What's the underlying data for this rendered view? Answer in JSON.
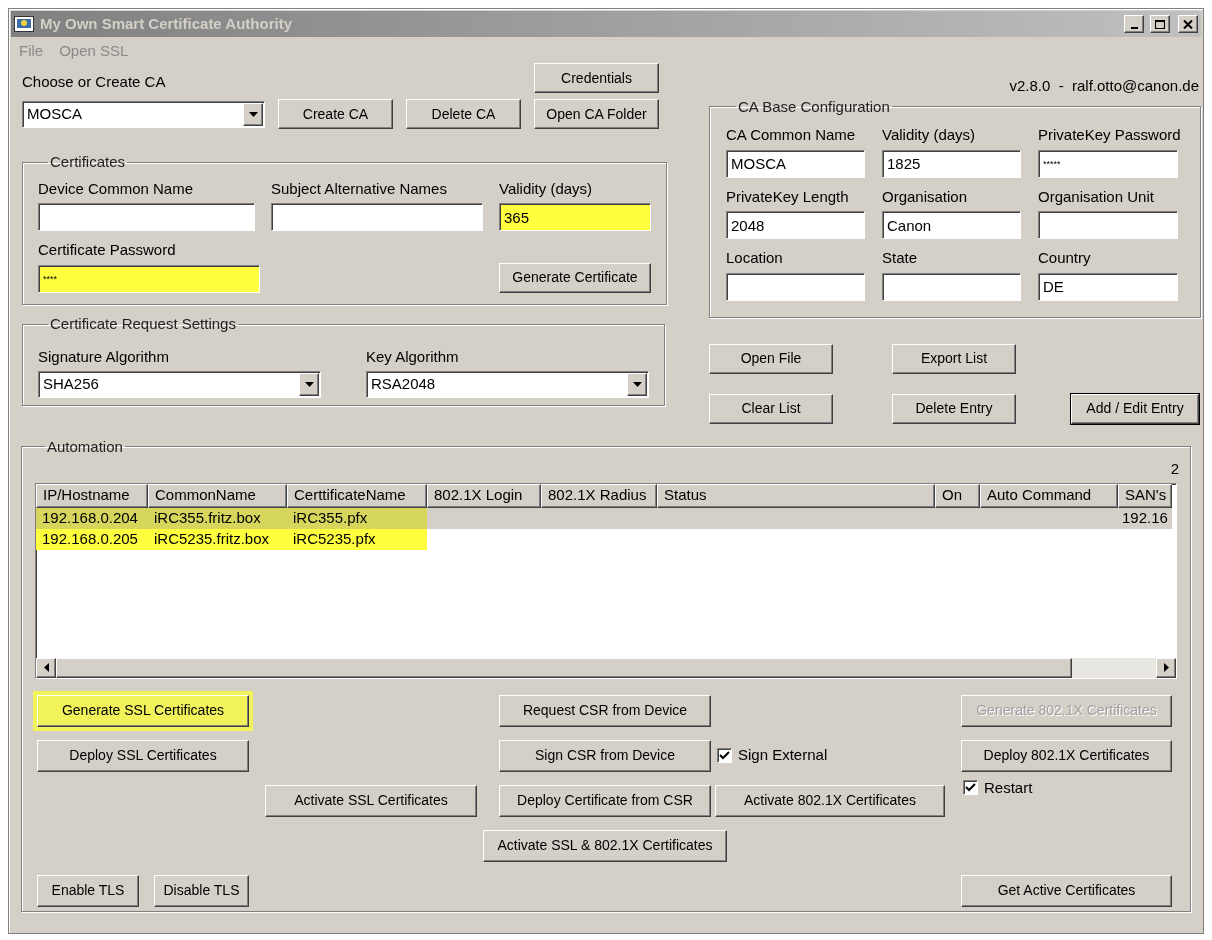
{
  "window": {
    "title": "My Own Smart Certificate Authority",
    "active": false
  },
  "menu": [
    {
      "label": "File"
    },
    {
      "label": "Open SSL"
    }
  ],
  "ca_chooser": {
    "label": "Choose or Create CA",
    "value": "MOSCA"
  },
  "top_buttons": [
    {
      "label": "Credentials"
    },
    {
      "label": "Create CA"
    },
    {
      "label": "Delete CA"
    },
    {
      "label": "Open CA Folder"
    }
  ],
  "version": "v2.8.0  -  ralf.otto@canon.de",
  "certificates": {
    "title": "Certificates",
    "fields": [
      {
        "label": "Device Common Name",
        "kind": "text",
        "highlighted": false
      },
      {
        "label": "Subject Alternative Names",
        "kind": "text",
        "highlighted": false
      },
      {
        "label": "Validity (days)",
        "value": "365",
        "kind": "text",
        "highlighted": true
      },
      {
        "label": "Certificate Password",
        "value": "****",
        "kind": "password",
        "highlighted": true
      }
    ],
    "button": {
      "label": "Generate Certificate"
    }
  },
  "request_settings": {
    "title": "Certificate Request Settings",
    "selects": [
      {
        "label": "Signature Algorithm",
        "value": "SHA256"
      },
      {
        "label": "Key Algorithm",
        "value": "RSA2048"
      }
    ]
  },
  "ca_base": {
    "title": "CA Base Configuration",
    "fields": [
      {
        "label": "CA Common Name",
        "value": "MOSCA",
        "kind": "text"
      },
      {
        "label": "Validity (days)",
        "value": "1825",
        "kind": "text"
      },
      {
        "label": "PrivateKey Password",
        "value": "*****",
        "kind": "password"
      },
      {
        "label": "PrivateKey Length",
        "value": "2048",
        "kind": "text"
      },
      {
        "label": "Organisation",
        "value": "Canon",
        "kind": "text"
      },
      {
        "label": "Organisation Unit",
        "kind": "text"
      },
      {
        "label": "Location",
        "kind": "text"
      },
      {
        "label": "State",
        "kind": "text"
      },
      {
        "label": "Country",
        "value": "DE",
        "kind": "text"
      }
    ]
  },
  "list_buttons": [
    {
      "label": "Open File",
      "default": false
    },
    {
      "label": "Export List",
      "default": false
    },
    {
      "label": "Clear List",
      "default": false
    },
    {
      "label": "Delete Entry",
      "default": false
    },
    {
      "label": "Add / Edit Entry",
      "default": true
    }
  ],
  "automation": {
    "title": "Automation",
    "count": "2",
    "table": {
      "columns": [
        "IP/Hostname",
        "CommonName",
        "CerttificateName",
        "802.1X Login",
        "802.1X Radius",
        "Status",
        "On",
        "Auto Command",
        "SAN's"
      ],
      "rows": [
        {
          "cells": [
            "192.168.0.204",
            "iRC355.fritz.box",
            "iRC355.pfx"
          ],
          "sans": "192.16",
          "selected": true,
          "highlighted": true
        },
        {
          "cells": [
            "192.168.0.205",
            "iRC5235.fritz.box",
            "iRC5235.pfx"
          ],
          "selected": false,
          "highlighted": true
        }
      ]
    },
    "controls": [
      {
        "kind": "button",
        "label": "Generate SSL Certificates",
        "highlighted": true,
        "disabled": false
      },
      {
        "kind": "button",
        "label": "Request CSR from Device",
        "highlighted": false,
        "disabled": false
      },
      {
        "kind": "button",
        "label": "Generate 802.1X Certificates",
        "highlighted": false,
        "disabled": true
      },
      {
        "kind": "button",
        "label": "Deploy SSL Certificates",
        "highlighted": false,
        "disabled": false
      },
      {
        "kind": "button",
        "label": "Sign CSR from Device",
        "highlighted": false,
        "disabled": false
      },
      {
        "kind": "checkbox",
        "label": "Sign External",
        "checked": true
      },
      {
        "kind": "button",
        "label": "Deploy 802.1X Certificates",
        "highlighted": false,
        "disabled": false
      },
      {
        "kind": "button",
        "label": "Activate SSL Certificates",
        "highlighted": false,
        "disabled": false
      },
      {
        "kind": "button",
        "label": "Deploy Certificate from CSR",
        "highlighted": false,
        "disabled": false
      },
      {
        "kind": "button",
        "label": "Activate 802.1X Certificates",
        "highlighted": false,
        "disabled": false
      },
      {
        "kind": "checkbox",
        "label": "Restart",
        "checked": true
      },
      {
        "kind": "button",
        "label": "Activate SSL & 802.1X Certificates",
        "highlighted": false,
        "disabled": false
      },
      {
        "kind": "button",
        "label": "Enable TLS",
        "highlighted": false,
        "disabled": false
      },
      {
        "kind": "button",
        "label": "Disable TLS",
        "highlighted": false,
        "disabled": false
      },
      {
        "kind": "button",
        "label": "Get Active Certificates",
        "highlighted": false,
        "disabled": false
      }
    ]
  }
}
